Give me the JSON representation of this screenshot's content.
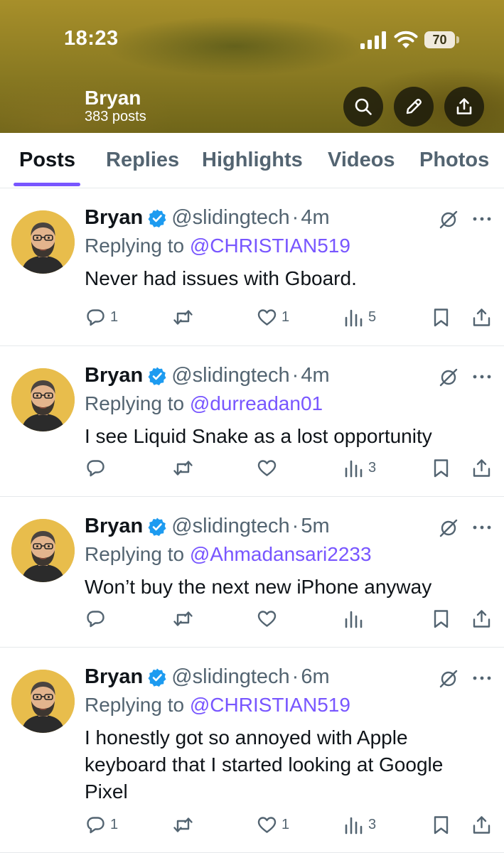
{
  "status_bar": {
    "time": "18:23",
    "battery": "70"
  },
  "profile": {
    "name": "Bryan",
    "posts_count": "383 posts"
  },
  "header_icons": [
    "search-icon",
    "pen-icon",
    "share-icon"
  ],
  "tabs": [
    {
      "label": "Posts",
      "active": true
    },
    {
      "label": "Replies",
      "active": false
    },
    {
      "label": "Highlights",
      "active": false
    },
    {
      "label": "Videos",
      "active": false
    },
    {
      "label": "Photos",
      "active": false
    }
  ],
  "colors": {
    "accent": "#7856ff",
    "verified": "#1d9bf0",
    "secondary_text": "#536471",
    "header_bg": "#8a7a22"
  },
  "posts": [
    {
      "name": "Bryan",
      "handle": "@slidingtech",
      "separator": "·",
      "time": "4m",
      "reply_prefix": "Replying to",
      "reply_to": "@CHRISTIAN519",
      "text": "Never had issues with Gboard.",
      "replies": "1",
      "reposts": "",
      "likes": "1",
      "views": "5"
    },
    {
      "name": "Bryan",
      "handle": "@slidingtech",
      "separator": "·",
      "time": "4m",
      "reply_prefix": "Replying to",
      "reply_to": "@durreadan01",
      "text": "I see Liquid Snake as a lost opportunity",
      "replies": "",
      "reposts": "",
      "likes": "",
      "views": "3"
    },
    {
      "name": "Bryan",
      "handle": "@slidingtech",
      "separator": "·",
      "time": "5m",
      "reply_prefix": "Replying to",
      "reply_to": "@Ahmadansari2233",
      "text": "Won’t buy the next new iPhone anyway",
      "replies": "",
      "reposts": "",
      "likes": "",
      "views": ""
    },
    {
      "name": "Bryan",
      "handle": "@slidingtech",
      "separator": "·",
      "time": "6m",
      "reply_prefix": "Replying to",
      "reply_to": "@CHRISTIAN519",
      "text": "I honestly got so annoyed with Apple keyboard that I started looking at Google Pixel",
      "replies": "1",
      "reposts": "",
      "likes": "1",
      "views": "3"
    }
  ]
}
